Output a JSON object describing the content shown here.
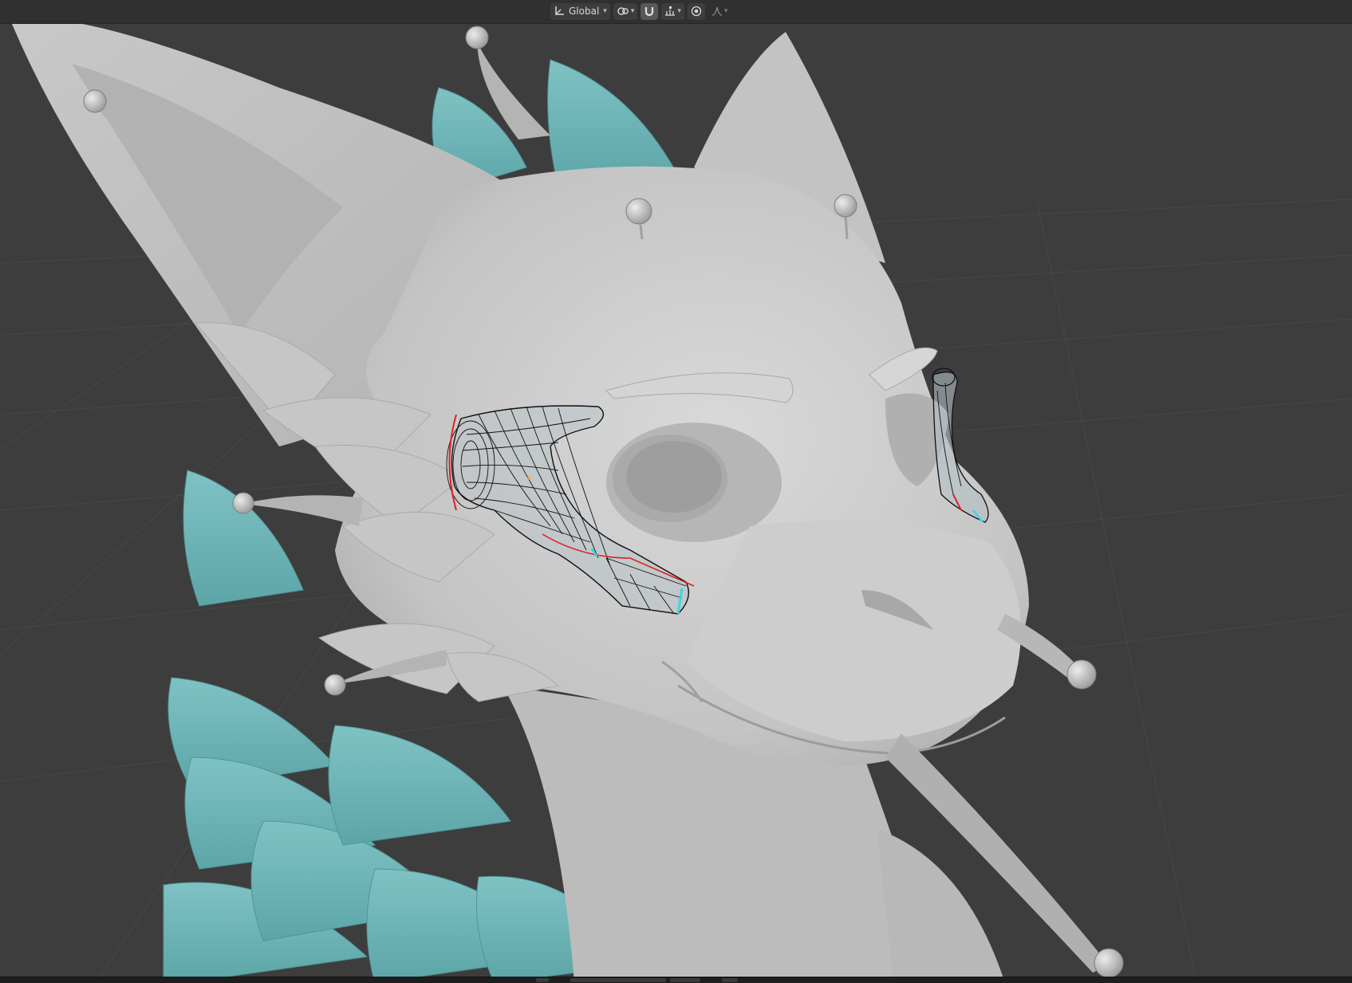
{
  "header": {
    "transform_orientation": {
      "label": "Global",
      "icon": "transform-orientation-icon"
    },
    "pivot": {
      "icon": "pivot-point-icon"
    },
    "snap": {
      "icon": "snap-magnet-icon",
      "target_icon": "snap-increment-icon"
    },
    "proportional_edit": {
      "icon": "proportional-editing-icon",
      "falloff_icon": "falloff-curve-icon"
    }
  },
  "viewport": {
    "mode": "edit-mesh",
    "colors": {
      "background": "#3d3d3d",
      "grid": "#474747",
      "model": "#c9c9c9",
      "spikes": "#6cb3b6",
      "wire": "#111111",
      "seam": "#e02020",
      "selected_edge": "#39d6e6"
    }
  }
}
